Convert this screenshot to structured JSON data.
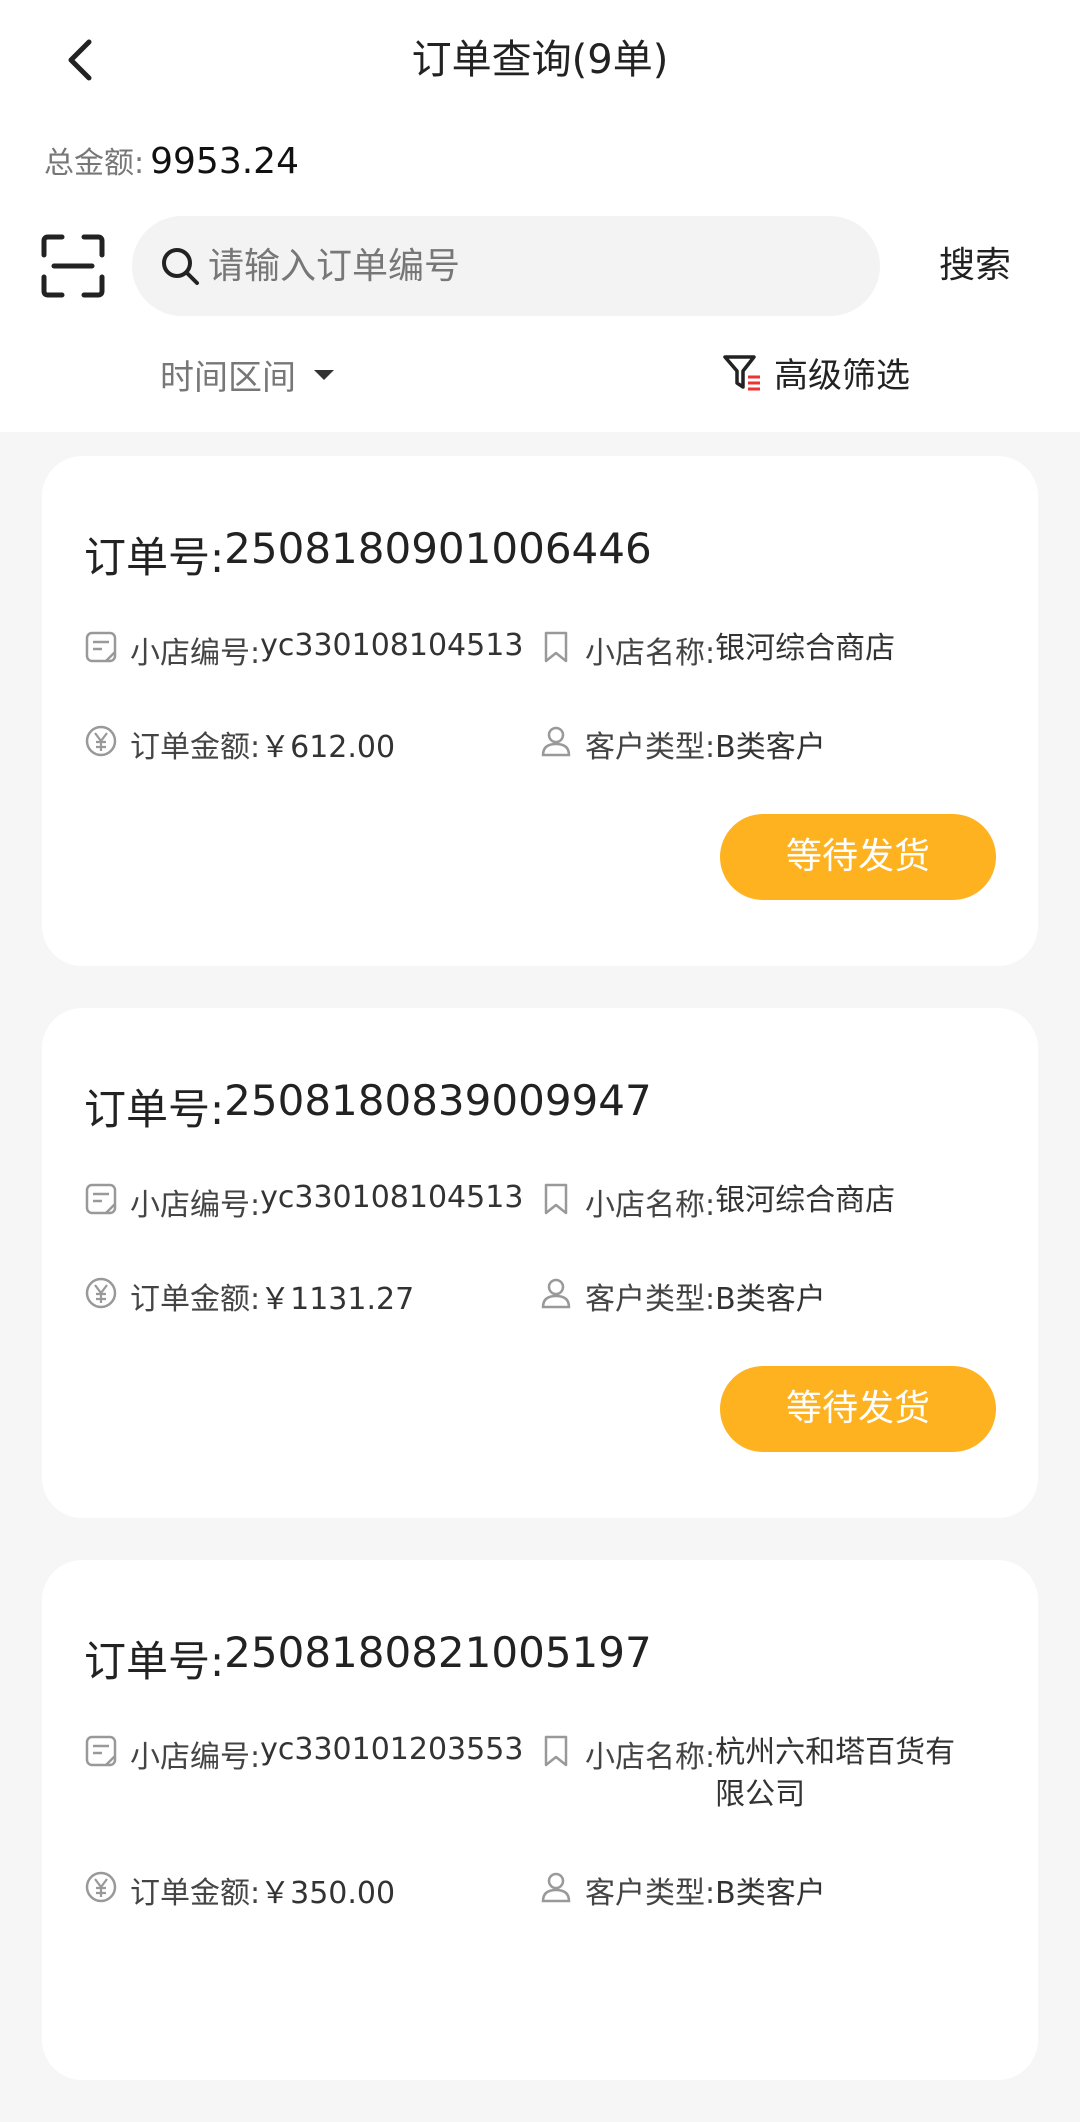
{
  "header": {
    "title": "订单查询(9单)"
  },
  "summary": {
    "total_label": "总金额:",
    "total_value": "9953.24"
  },
  "search": {
    "placeholder": "请输入订单编号",
    "button_label": "搜索"
  },
  "filters": {
    "time_label": "时间区间",
    "advanced_label": "高级筛选"
  },
  "labels": {
    "order_no": "订单号:",
    "shop_code": "小店编号:",
    "shop_name": "小店名称:",
    "amount": "订单金额:",
    "customer_type": "客户类型:"
  },
  "orders": [
    {
      "order_no": "2508180901006446",
      "shop_code": "yc330108104513",
      "shop_name": "银河综合商店",
      "amount": "￥612.00",
      "customer_type": "B类客户",
      "status": "等待发货"
    },
    {
      "order_no": "2508180839009947",
      "shop_code": "yc330108104513",
      "shop_name": "银河综合商店",
      "amount": "￥1131.27",
      "customer_type": "B类客户",
      "status": "等待发货"
    },
    {
      "order_no": "2508180821005197",
      "shop_code": "yc330101203553",
      "shop_name": "杭州六和塔百货有限公司",
      "amount": "￥350.00",
      "customer_type": "B类客户",
      "status": ""
    }
  ],
  "colors": {
    "accent": "#ffb21f",
    "background": "#f6f6f6"
  }
}
